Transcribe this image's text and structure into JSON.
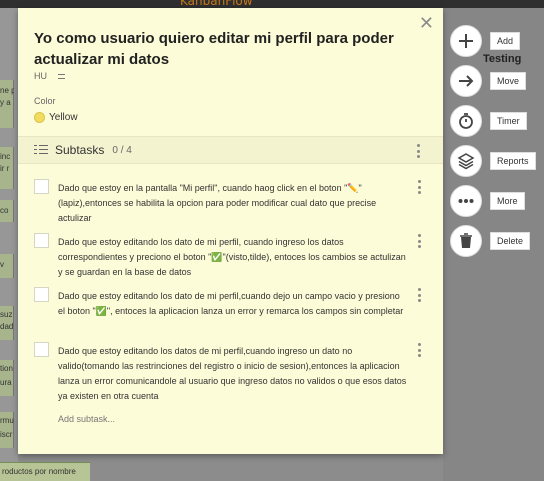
{
  "app": {
    "logo_text": "KanbanFlow"
  },
  "board": {
    "testing_column": "Testing",
    "left_strip_texts": [
      "ne p",
      "y a",
      "inc",
      "ir r",
      "co",
      "v",
      "suz",
      "dad",
      "tion",
      "ura r",
      "rmu",
      "iscr"
    ],
    "bottom_card": "roductos por nombre"
  },
  "task": {
    "title": "Yo como usuario quiero editar mi perfil para poder actualizar mi datos",
    "user_initials": "HU",
    "color_label": "Color",
    "color_name": "Yellow",
    "color_hex": "#f1dc5e",
    "close_glyph": "✕"
  },
  "subtasks": {
    "title": "Subtasks",
    "count": "0 / 4",
    "add_label": "Add subtask...",
    "items": [
      {
        "text": "Dado que estoy en la pantalla \"Mi perfil\", cuando haog click en el boton \"✏️\" (lapiz),entonces se habilita la opcion para poder modificar cual dato que precise actulizar",
        "done": false
      },
      {
        "text": "Dado que estoy editando los dato de mi perfil, cuando ingreso los datos correspondientes y preciono el boton \"✅\"(visto,tilde), entoces los cambios se actulizan y se guardan en la base de datos",
        "done": false
      },
      {
        "text": "Dado que estoy editando los dato de mi perfil,cuando dejo un campo vacio y presiono el boton \"✅\", entoces la aplicacion lanza un error y remarca los campos sin completar",
        "done": false
      },
      {
        "text": "Dado que estoy editando los datos de mi perfil,cuando ingreso un dato no valido(tomando las restrinciones del registro o inicio de sesion),entonces la aplicacion lanza un error comunicandole al usuario que ingreso datos no validos o que esos datos ya existen en otra cuenta",
        "done": false
      }
    ]
  },
  "actions": [
    {
      "label": "Add",
      "icon": "plus-icon"
    },
    {
      "label": "Move",
      "icon": "arrow-right-icon"
    },
    {
      "label": "Timer",
      "icon": "stopwatch-icon"
    },
    {
      "label": "Reports",
      "icon": "layers-icon"
    },
    {
      "label": "More",
      "icon": "more-dots-icon"
    },
    {
      "label": "Delete",
      "icon": "trash-icon"
    }
  ]
}
